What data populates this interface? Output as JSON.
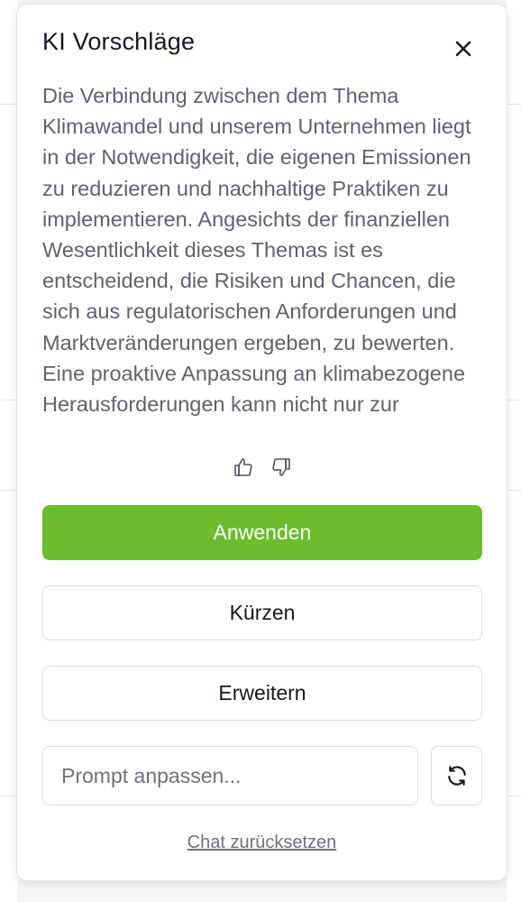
{
  "panel": {
    "title": "KI Vorschläge",
    "close_icon": "close-icon",
    "suggestion_text": "Die Verbindung zwischen dem Thema Klimawandel und unserem Unternehmen liegt in der Notwendigkeit, die eigenen Emissionen zu reduzieren und nachhaltige Praktiken zu implementieren. Angesichts der finanziellen Wesentlichkeit dieses Themas ist es entscheidend, die Risiken und Chancen, die sich aus regulatorischen Anforderungen und Marktveränderungen ergeben, zu bewerten. Eine proaktive Anpassung an klimabezogene Herausforderungen kann nicht nur zur",
    "feedback": {
      "like_icon": "thumbs-up-icon",
      "dislike_icon": "thumbs-down-icon"
    },
    "buttons": {
      "apply_label": "Anwenden",
      "shorten_label": "Kürzen",
      "expand_label": "Erweitern"
    },
    "prompt": {
      "placeholder": "Prompt anpassen...",
      "value": ""
    },
    "refresh_icon": "refresh-icon",
    "reset_label": "Chat zurücksetzen"
  },
  "colors": {
    "accent": "#6cbd2e",
    "text_primary": "#111827",
    "text_secondary": "#5b6472",
    "border": "#d7dbe0"
  }
}
